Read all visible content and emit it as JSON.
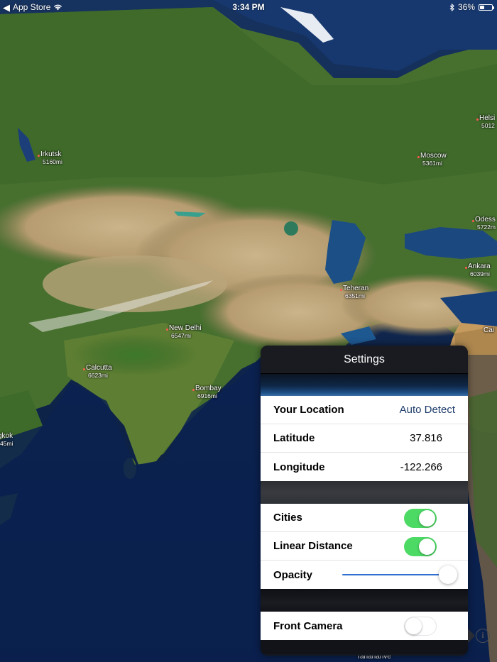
{
  "status_bar": {
    "back_app": "App Store",
    "time": "3:34 PM",
    "battery": "36%",
    "battery_level": 0.36
  },
  "cities": [
    {
      "name": "Irkutsk",
      "distance": "5160mi"
    },
    {
      "name": "Moscow",
      "distance": "5361mi"
    },
    {
      "name": "Helsi",
      "distance": "5012"
    },
    {
      "name": "Odess",
      "distance": "5722m"
    },
    {
      "name": "Ankara",
      "distance": "6039mi"
    },
    {
      "name": "Teheran",
      "distance": "6351mi"
    },
    {
      "name": "New Delhi",
      "distance": "6547mi"
    },
    {
      "name": "Calcutta",
      "distance": "6623mi"
    },
    {
      "name": "Bombay",
      "distance": "6916mi"
    },
    {
      "name": "gkok",
      "distance": "45mi"
    },
    {
      "name": "Cai",
      "distance": ""
    },
    {
      "name": "Tananarive",
      "distance": ""
    }
  ],
  "settings": {
    "title": "Settings",
    "location": {
      "label": "Your Location",
      "value": "Auto Detect"
    },
    "latitude": {
      "label": "Latitude",
      "value": "37.816"
    },
    "longitude": {
      "label": "Longitude",
      "value": "-122.266"
    },
    "cities": {
      "label": "Cities",
      "on": true
    },
    "linear_distance": {
      "label": "Linear Distance",
      "on": true
    },
    "opacity": {
      "label": "Opacity",
      "level": 1.0
    },
    "front_camera": {
      "label": "Front Camera",
      "on": false
    }
  },
  "info_button": {
    "glyph": "i"
  },
  "colors": {
    "switch_on": "#4cd964",
    "slider_track": "#2f6fd0",
    "auto_detect": "#1f3d6b"
  }
}
